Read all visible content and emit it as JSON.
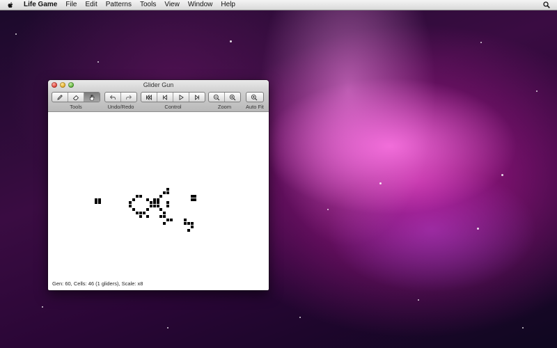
{
  "menubar": {
    "items": [
      "Life Game",
      "File",
      "Edit",
      "Patterns",
      "Tools",
      "View",
      "Window",
      "Help"
    ]
  },
  "window": {
    "title": "Glider Gun",
    "toolbar": {
      "groups": [
        {
          "label": "Tools",
          "buttons": [
            "pencil-icon",
            "eraser-icon",
            "hand-icon"
          ],
          "active": "hand-icon"
        },
        {
          "label": "Undo/Redo",
          "buttons": [
            "undo-icon",
            "redo-icon"
          ]
        },
        {
          "label": "Control",
          "buttons": [
            "rewind-icon",
            "step-back-icon",
            "play-icon",
            "step-forward-icon"
          ]
        },
        {
          "label": "Zoom",
          "buttons": [
            "zoom-out-icon",
            "zoom-in-icon"
          ]
        },
        {
          "label": "Auto Fit",
          "buttons": [
            "auto-fit-icon"
          ]
        }
      ]
    },
    "status": "Gen: 60, Cells: 46 (1 gliders), Scale: x8",
    "grid": {
      "cells": [
        [
          17,
          15
        ],
        [
          18,
          15
        ],
        [
          17,
          16
        ],
        [
          18,
          16
        ],
        [
          29,
          14
        ],
        [
          30,
          14
        ],
        [
          28,
          15
        ],
        [
          32,
          15
        ],
        [
          27,
          16
        ],
        [
          33,
          16
        ],
        [
          38,
          16
        ],
        [
          27,
          17
        ],
        [
          33,
          17
        ],
        [
          28,
          18
        ],
        [
          32,
          18
        ],
        [
          29,
          19
        ],
        [
          30,
          19
        ],
        [
          34,
          15
        ],
        [
          35,
          15
        ],
        [
          34,
          16
        ],
        [
          35,
          16
        ],
        [
          34,
          17
        ],
        [
          35,
          17
        ],
        [
          36,
          14
        ],
        [
          36,
          18
        ],
        [
          37,
          13
        ],
        [
          37,
          19
        ],
        [
          45,
          14
        ],
        [
          46,
          14
        ],
        [
          45,
          15
        ],
        [
          46,
          15
        ],
        [
          38,
          12
        ],
        [
          38,
          17
        ],
        [
          36,
          20
        ],
        [
          37,
          20
        ],
        [
          38,
          21
        ],
        [
          39,
          21
        ],
        [
          37,
          22
        ],
        [
          43,
          22
        ],
        [
          44,
          22
        ],
        [
          45,
          22
        ],
        [
          45,
          23
        ],
        [
          44,
          24
        ],
        [
          31,
          19
        ],
        [
          32,
          20
        ],
        [
          38,
          13
        ],
        [
          30,
          20
        ],
        [
          43,
          21
        ]
      ]
    }
  },
  "colors": {
    "cell": "#000000",
    "active_tool": "#8a8a8a"
  }
}
